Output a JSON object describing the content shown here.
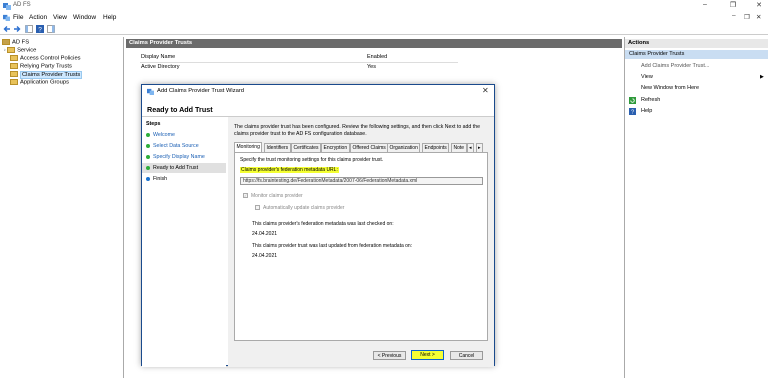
{
  "window": {
    "title": "AD FS",
    "controls": [
      "–",
      "❐",
      "✕"
    ]
  },
  "menu": [
    "File",
    "Action",
    "View",
    "Window",
    "Help"
  ],
  "tree": {
    "root": "AD FS",
    "items": [
      "Service",
      "Access Control Policies",
      "Relying Party Trusts",
      "Claims Provider Trusts",
      "Application Groups"
    ]
  },
  "center": {
    "header": "Claims Provider Trusts",
    "columns": [
      "Display Name",
      "Enabled"
    ],
    "rows": [
      {
        "name": "Active Directory",
        "enabled": "Yes"
      }
    ]
  },
  "actions": {
    "header": "Actions",
    "subheader": "Claims Provider Trusts",
    "items": [
      "Add Claims Provider Trust...",
      "View",
      "New Window from Here",
      "Refresh",
      "Help"
    ]
  },
  "dialog": {
    "title": "Add Claims Provider Trust Wizard",
    "heading": "Ready to Add Trust",
    "steps_label": "Steps",
    "steps": [
      "Welcome",
      "Select Data Source",
      "Specify Display Name",
      "Ready to Add Trust",
      "Finish"
    ],
    "description": "The claims provider trust has been configured. Review the following settings, and then click Next to add the claims provider trust to the AD FS configuration database.",
    "tabs": [
      "Monitoring",
      "Identifiers",
      "Certificates",
      "Encryption",
      "Offered Claims",
      "Organization",
      "Endpoints",
      "Note"
    ],
    "tab_scroll": [
      "◂",
      "▸"
    ],
    "monitoring": {
      "intro": "Specify the trust monitoring settings for this claims provider trust.",
      "url_label": "Claims provider's federation metadata URL:",
      "url_value": "https://fs.braintesting.de/FederationMetadata/2007-06/FederationMetadata.xml",
      "monitor_label": "Monitor claims provider",
      "auto_update_label": "Automatically update claims provider",
      "last_checked_label": "This claims provider's federation metadata was last checked on:",
      "last_checked_value": "24.04.2021",
      "last_updated_label": "This claims provider trust was last updated from federation metadata on:",
      "last_updated_value": "24.04.2021"
    },
    "buttons": {
      "previous": "< Previous",
      "next": "Next >",
      "cancel": "Cancel"
    }
  },
  "colors": {
    "highlight": "#f4ff33",
    "link": "#1a5fb4",
    "header_gray": "#6b6b6b",
    "green_dot": "#2eae3a",
    "blue_dot": "#1a73d0"
  }
}
